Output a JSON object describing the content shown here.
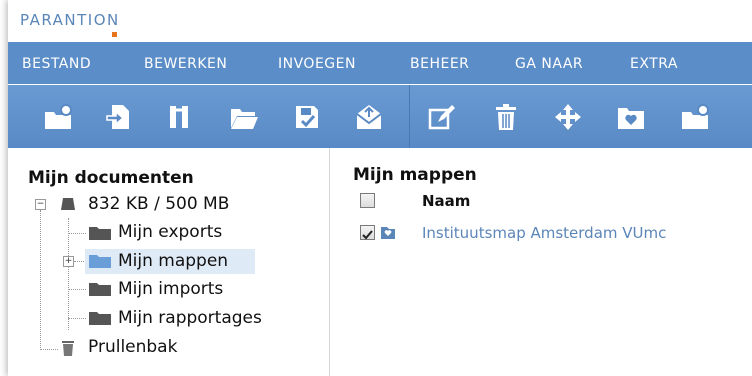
{
  "brand": {
    "logo_text": "PARANTION",
    "accent": "#e8741a",
    "primary": "#5b8dc8"
  },
  "menu": [
    "BESTAND",
    "BEWERKEN",
    "INVOEGEN",
    "BEHEER",
    "GA NAAR",
    "EXTRA"
  ],
  "toolbar": {
    "icons": [
      "new-folder-icon",
      "import-icon",
      "relations-icon",
      "open-folder-icon",
      "save-icon",
      "mail-icon",
      "edit-icon",
      "delete-icon",
      "move-icon",
      "favorite-folder-icon",
      "folder-settings-icon"
    ]
  },
  "tree": {
    "title": "Mijn documenten",
    "quota": "832 KB / 500 MB",
    "items": [
      "Mijn exports",
      "Mijn mappen",
      "Mijn imports",
      "Mijn rapportages"
    ],
    "trash": "Prullenbak",
    "selected": "Mijn mappen"
  },
  "content": {
    "title": "Mijn mappen",
    "column_header": "Naam",
    "rows": [
      {
        "name": "Instituutsmap Amsterdam VUmc",
        "checked": true
      }
    ]
  }
}
